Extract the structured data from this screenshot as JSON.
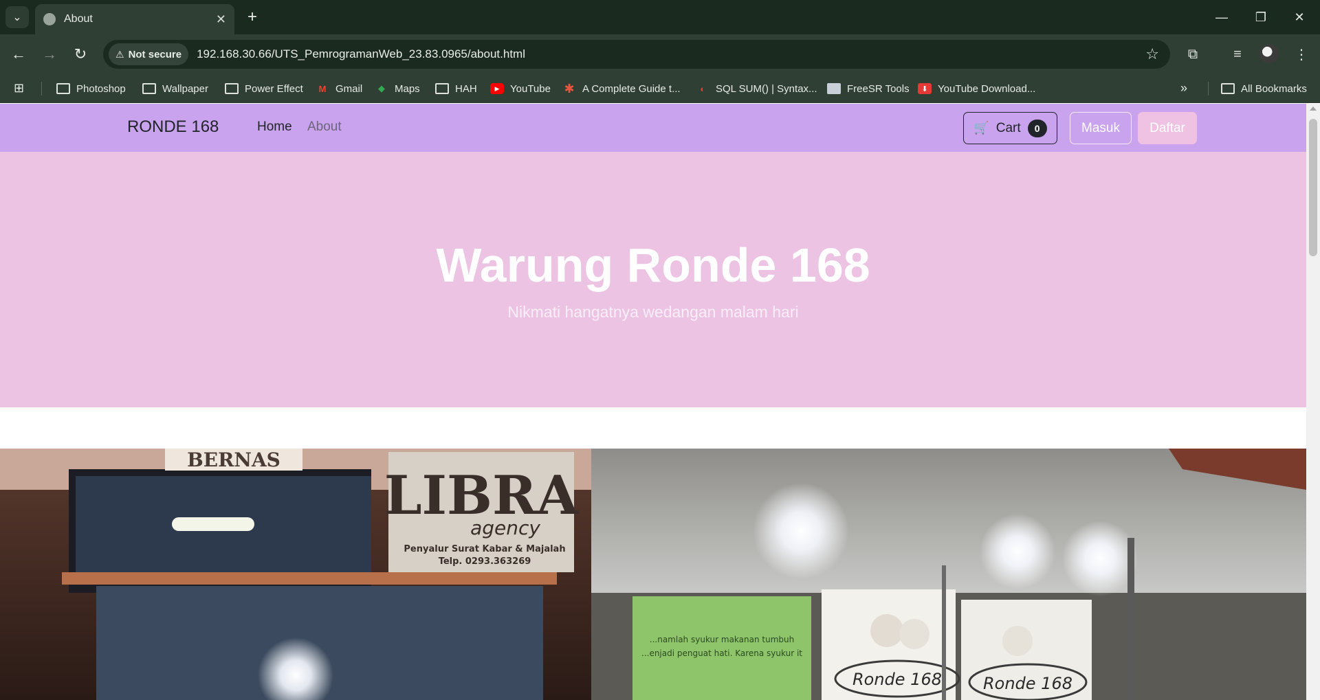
{
  "browser": {
    "tab_title": "About",
    "tab_close": "✕",
    "new_tab": "+",
    "security_label": "Not secure",
    "url": "192.168.30.66/UTS_PemrogramanWeb_23.83.0965/about.html",
    "bookmarks": [
      {
        "label": "Photoshop",
        "icon": "folder-icon"
      },
      {
        "label": "Wallpaper",
        "icon": "folder-icon"
      },
      {
        "label": "Power Effect",
        "icon": "folder-icon"
      },
      {
        "label": "Gmail",
        "icon": "gmail-icon"
      },
      {
        "label": "Maps",
        "icon": "maps-icon"
      },
      {
        "label": "HAH",
        "icon": "folder-icon"
      },
      {
        "label": "YouTube",
        "icon": "youtube-icon"
      },
      {
        "label": "A Complete Guide t...",
        "icon": "asterisk-icon"
      },
      {
        "label": "SQL SUM() | Syntax...",
        "icon": "sql-icon"
      },
      {
        "label": "FreeSR Tools",
        "icon": "freesr-icon"
      },
      {
        "label": "YouTube Download...",
        "icon": "download-icon"
      }
    ],
    "all_bookmarks": "All Bookmarks"
  },
  "site": {
    "brand": "RONDE 168",
    "nav": [
      {
        "label": "Home",
        "active": true
      },
      {
        "label": "About",
        "active": false
      }
    ],
    "cart_label": "Cart",
    "cart_count": "0",
    "login_label": "Masuk",
    "register_label": "Daftar",
    "hero_title": "Warung Ronde 168",
    "hero_subtitle": "Nikmati hangatnya wedangan malam hari"
  },
  "photo": {
    "sign_bernas": "BERNAS",
    "sign_libra": "LIBRA",
    "sign_agency": "agency",
    "sign_line1": "Penyalur Surat Kabar & Majalah",
    "sign_line2": "Telp. 0293.363269",
    "banner_text1": "Ronde 168",
    "banner_text2": "Ronde 168",
    "green_banner_line1": "...namlah syukur makanan tumbuh",
    "green_banner_line2": "...enjadi penguat hati. Karena syukur it"
  },
  "colors": {
    "navbar": "#c9a3ee",
    "hero": "#edc3e4",
    "chrome_dark": "#1b2a1f",
    "chrome": "#2f3f34"
  }
}
